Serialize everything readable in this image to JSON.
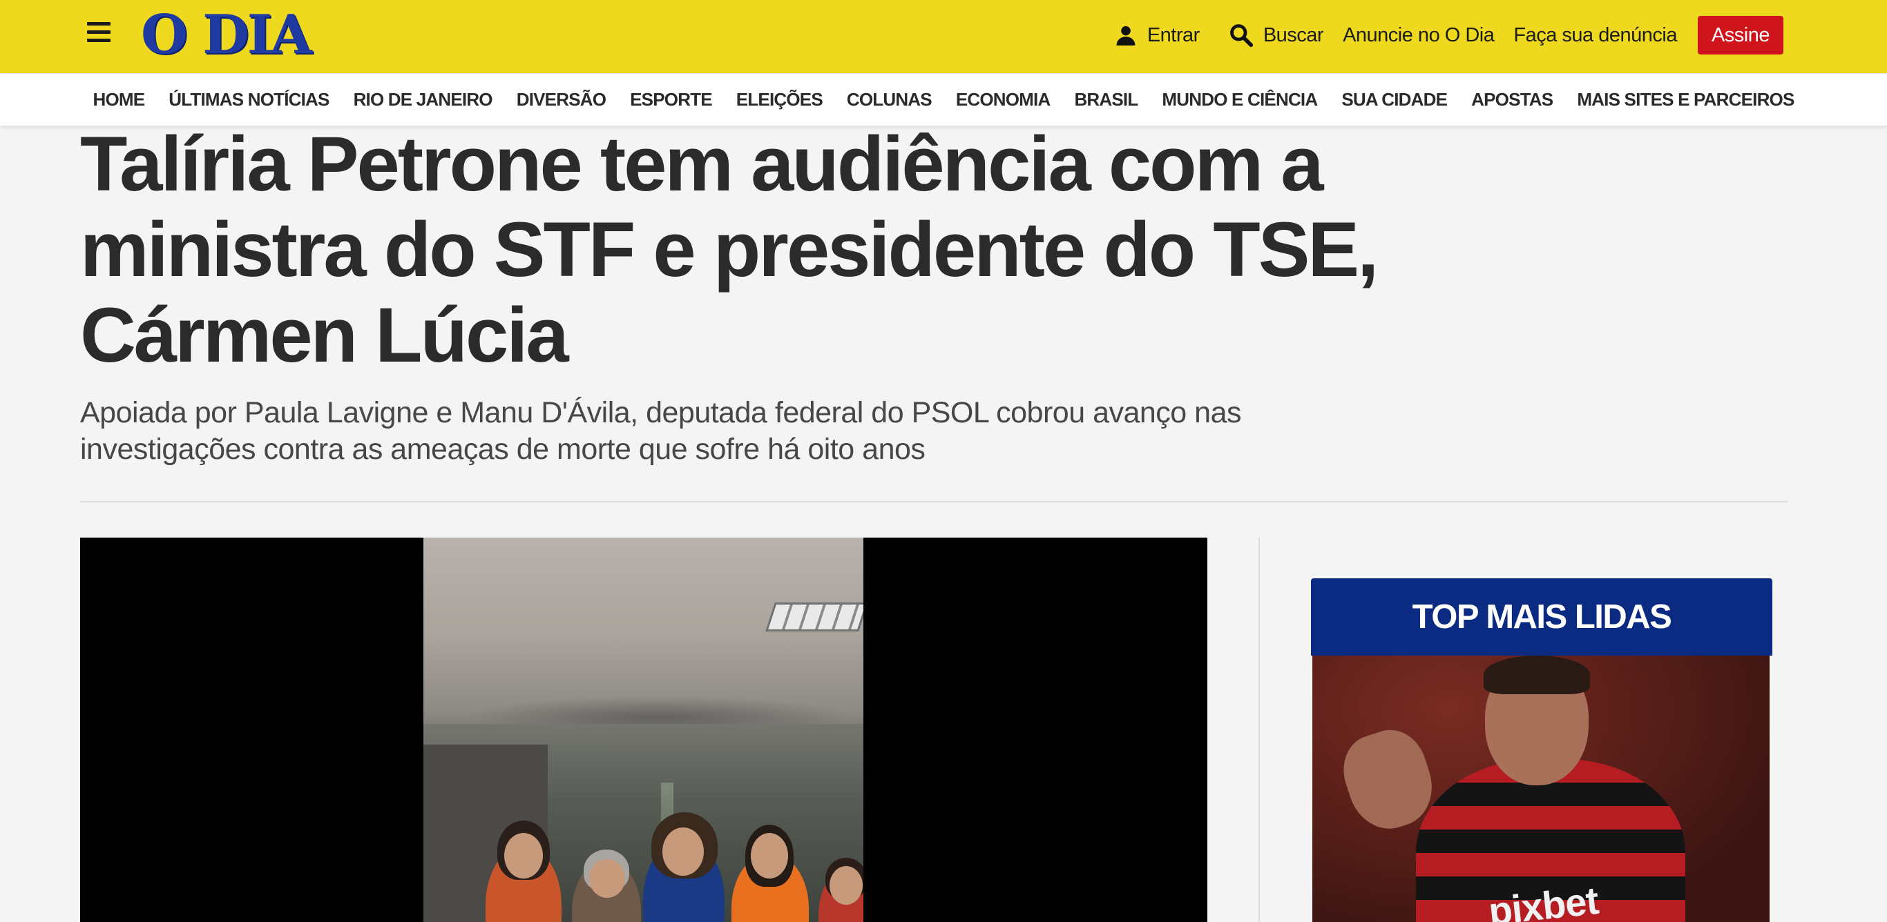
{
  "header": {
    "logo_text": "O DIA",
    "entrar_label": "Entrar",
    "buscar_label": "Buscar",
    "anuncie_label": "Anuncie no O Dia",
    "denuncia_label": "Faça sua denúncia",
    "assine_label": "Assine"
  },
  "nav": {
    "items": [
      "HOME",
      "ÚLTIMAS NOTÍCIAS",
      "RIO DE JANEIRO",
      "DIVERSÃO",
      "ESPORTE",
      "ELEIÇÕES",
      "COLUNAS",
      "ECONOMIA",
      "BRASIL",
      "MUNDO E CIÊNCIA",
      "SUA CIDADE",
      "APOSTAS",
      "MAIS SITES E PARCEIROS"
    ]
  },
  "article": {
    "title_line1": "Talíria Petrone tem audiência com a",
    "title_line2": "ministra do STF e presidente do TSE,",
    "title_line3": "Cármen Lúcia",
    "subtitle_line1": "Apoiada por Paula Lavigne e Manu D'Ávila, deputada federal do PSOL cobrou avanço nas",
    "subtitle_line2": "investigações contra as ameaças de morte que sofre há oito anos"
  },
  "sidebar": {
    "top_widget_title": "TOP MAIS LIDAS",
    "thumb_sponsor_text": "pixbet"
  },
  "colors": {
    "header_yellow": "#efd91f",
    "logo_blue": "#1f3aa0",
    "assine_red": "#d0141b",
    "widget_blue": "#0b2a82"
  },
  "icons": {
    "menu": "hamburger-menu-icon",
    "user": "user-icon",
    "search": "search-icon"
  }
}
